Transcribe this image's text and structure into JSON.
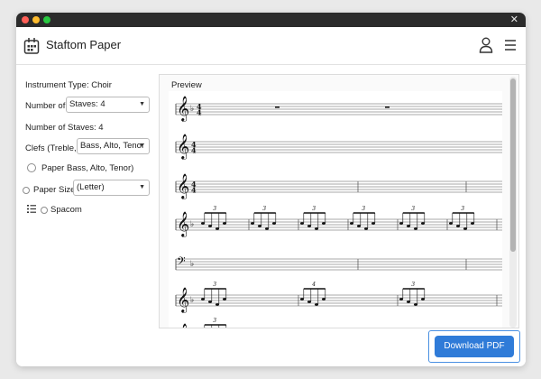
{
  "app": {
    "title": "Staftom Paper"
  },
  "sidebar": {
    "instrument_type": "Instrument Type: Choir",
    "staves_select_label": "Number of",
    "staves_select_value": "Staves: 4",
    "staves_text": "Number of Staves: 4",
    "clefs_label": "Clefs (Treble,",
    "clefs_value": "Bass, Alto, Tenor",
    "radio_option": "Paper Bass, Alto, Tenor)",
    "paper_size_label": "Paper Size",
    "paper_size_value": "(Letter)",
    "spacom_label": "Spacom"
  },
  "preview": {
    "label": "Preview",
    "systems": [
      {
        "clef": "treble",
        "time": "4/4",
        "key_flats": 1
      },
      {
        "clef": "treble",
        "time": "4/4",
        "key_flats": 0
      },
      {
        "clef": "treble",
        "time": "4/4",
        "key_flats": 0
      },
      {
        "clef": "treble",
        "key_flats": 1,
        "tuplets": [
          "3",
          "3",
          "3",
          "3",
          "3",
          "3"
        ]
      },
      {
        "clef": "bass",
        "key_flats": 1
      },
      {
        "clef": "treble",
        "key_flats": 1,
        "tuplets": [
          "3",
          "4",
          "3"
        ]
      },
      {
        "clef": "treble",
        "key_flats": 1,
        "tuplets": [
          "3"
        ]
      }
    ]
  },
  "footer": {
    "download_label": "Download PDF"
  },
  "colors": {
    "accent": "#2f7bd8",
    "titlebar": "#2b2b2b"
  }
}
